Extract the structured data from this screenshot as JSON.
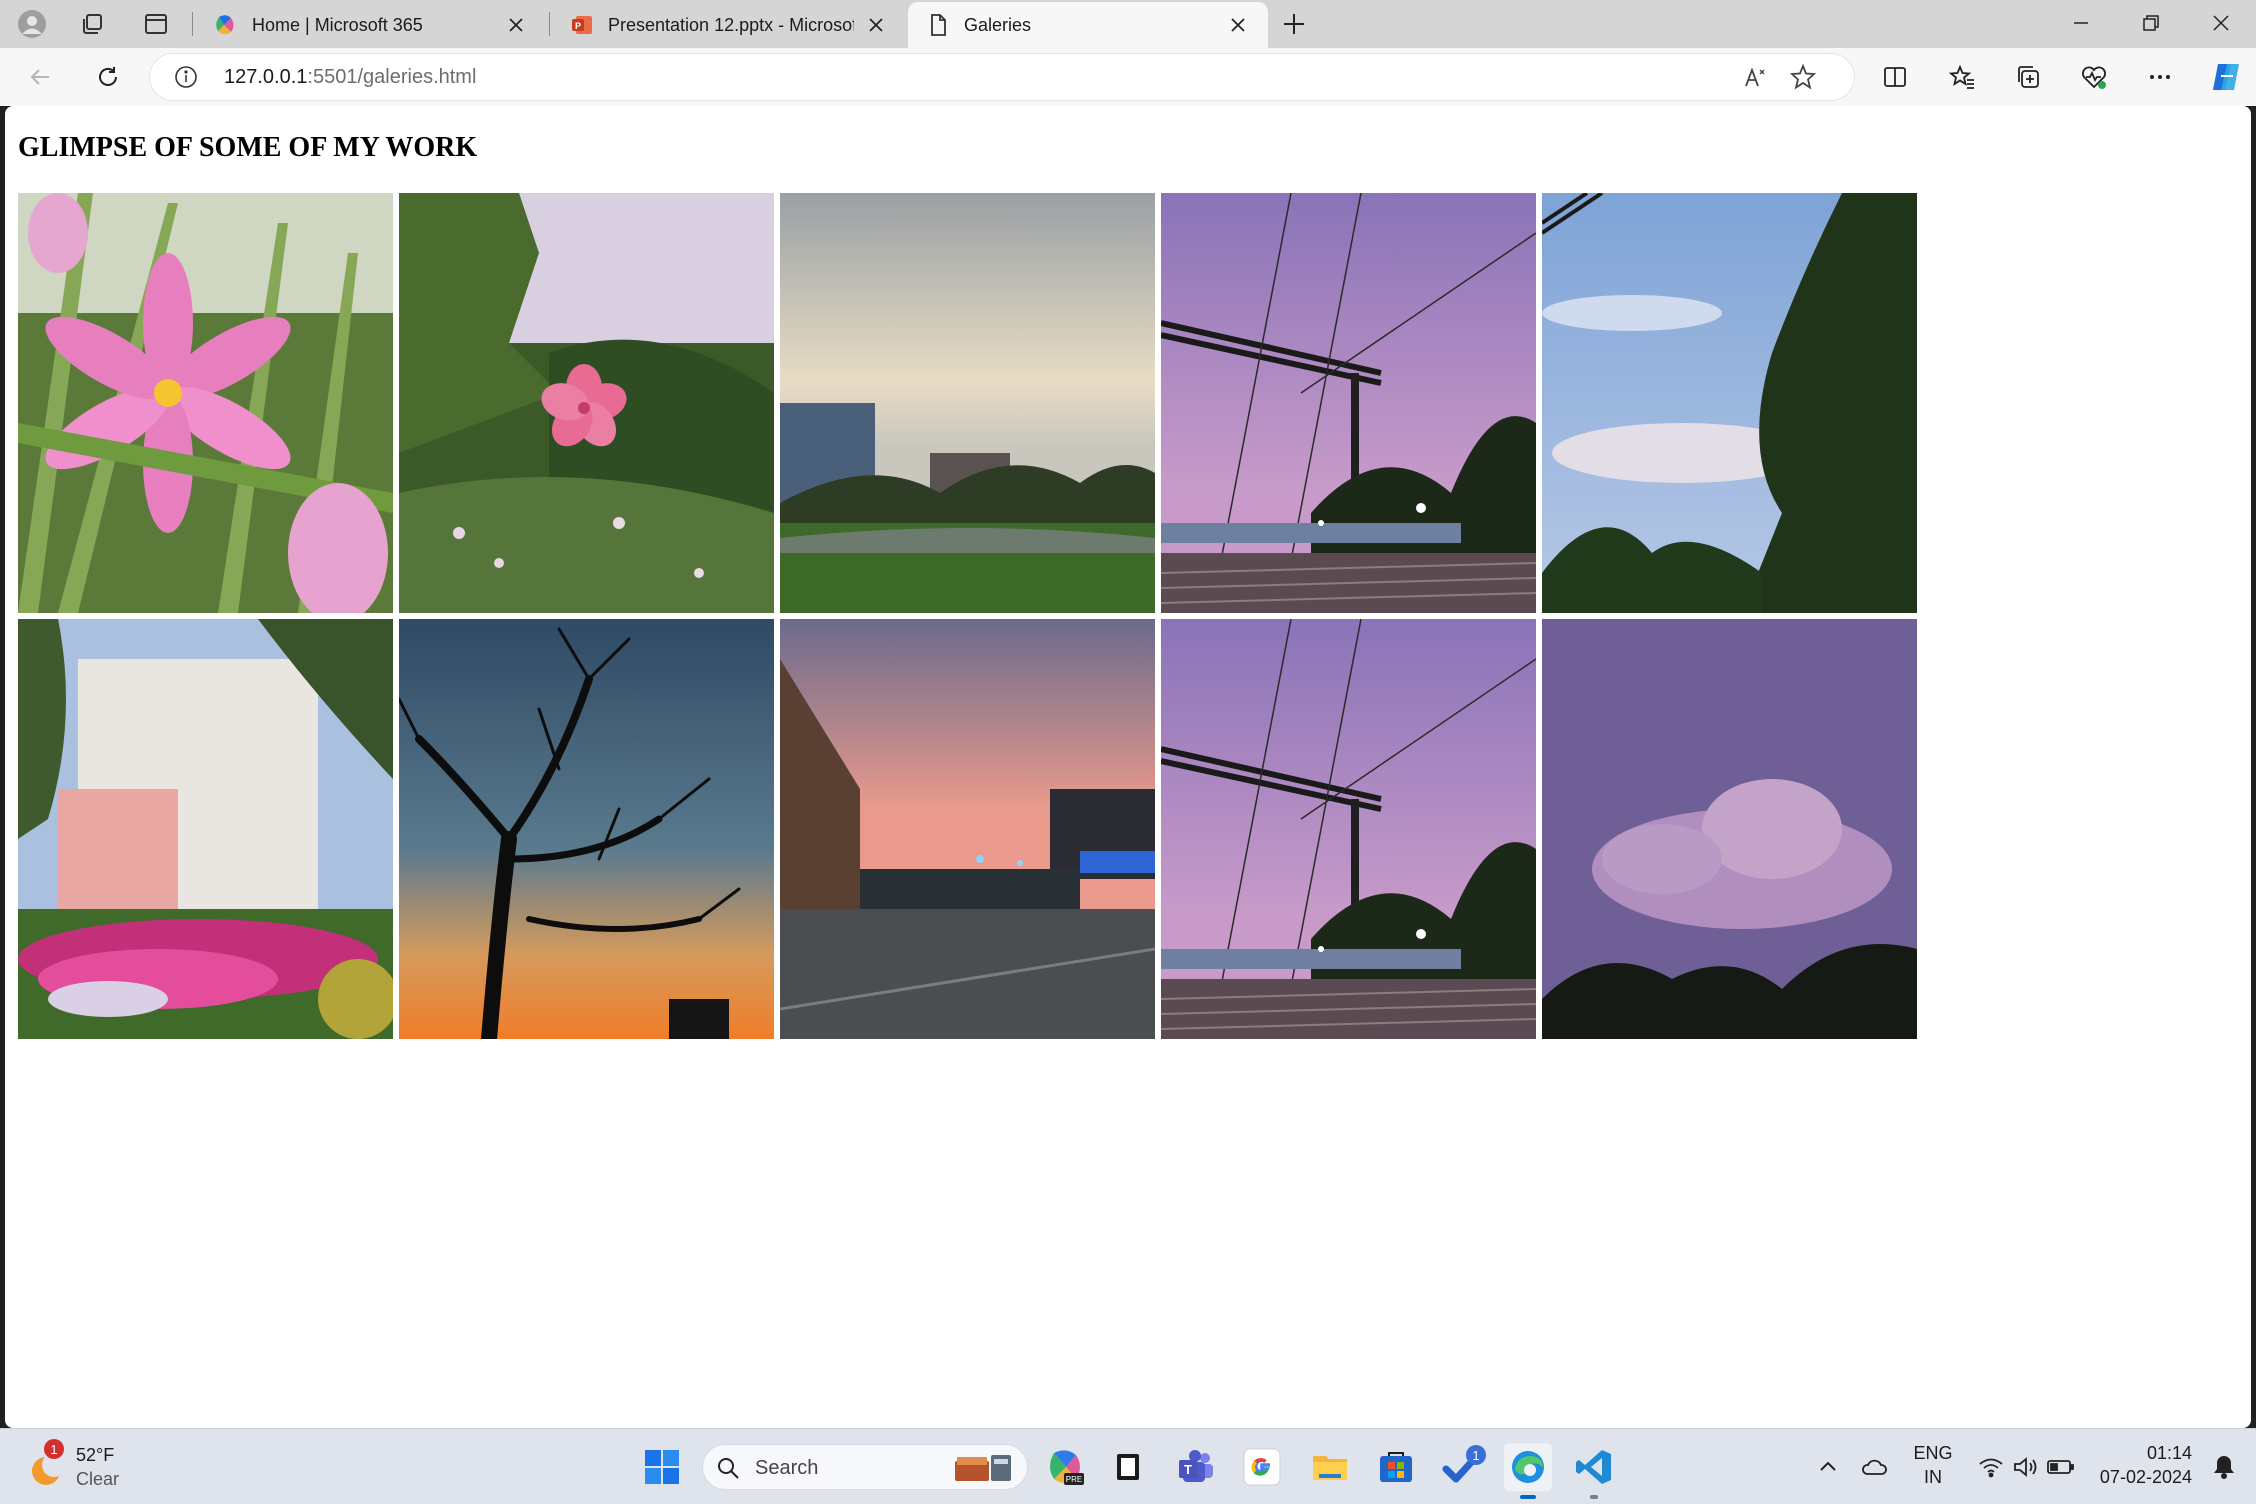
{
  "browser": {
    "tabs": [
      {
        "label": "Home | Microsoft 365",
        "icon": "copilot-m365-icon"
      },
      {
        "label": "Presentation 12.pptx - Microsoft",
        "icon": "powerpoint-icon"
      },
      {
        "label": "Galeries",
        "icon": "page-icon",
        "active": true
      }
    ],
    "address": {
      "host": "127.0.0.1",
      "rest": ":5501/galeries.html"
    }
  },
  "page": {
    "heading": "GLIMPSE OF SOME OF MY WORK",
    "photos": [
      {
        "subject": "pink-rain-lily-flowers"
      },
      {
        "subject": "pink-hibiscus-against-sky"
      },
      {
        "subject": "sunset-over-campus-garden"
      },
      {
        "subject": "railway-overhead-wires-purple-dusk"
      },
      {
        "subject": "blue-sky-with-trees"
      },
      {
        "subject": "building-with-flower-beds"
      },
      {
        "subject": "bare-tree-silhouette-at-dusk"
      },
      {
        "subject": "street-at-sunset-with-mall"
      },
      {
        "subject": "railway-overhead-wires-purple-dusk"
      },
      {
        "subject": "purple-sky-with-clouds"
      }
    ]
  },
  "taskbar": {
    "weather": {
      "temp": "52°F",
      "condition": "Clear",
      "badge": "1"
    },
    "search_label": "Search",
    "language": {
      "line1": "ENG",
      "line2": "IN"
    },
    "clock": {
      "time": "01:14",
      "date": "07-02-2024"
    },
    "todo_badge": "1"
  },
  "colors": {
    "accent": "#0067c0",
    "tabstrip": "#d5d5d5",
    "toolbar": "#f7f7f7"
  }
}
